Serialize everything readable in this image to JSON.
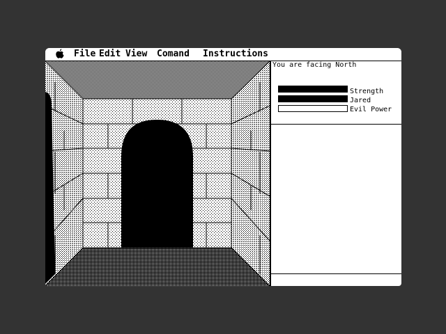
{
  "menubar": {
    "apple_icon": "apple-icon",
    "items": [
      "File",
      "Edit",
      "View",
      "Comand",
      "Instructions"
    ]
  },
  "status": {
    "facing_text": "You are facing North"
  },
  "stats": [
    {
      "label": "Strength",
      "level": 1.0
    },
    {
      "label": "Jared",
      "level": 1.0
    },
    {
      "label": "Evil Power",
      "level": 0.0
    }
  ],
  "scene": {
    "direction": "North",
    "features": [
      "stone-brick-corridor",
      "arched-doorway-ahead",
      "doorway-left-wall"
    ]
  }
}
